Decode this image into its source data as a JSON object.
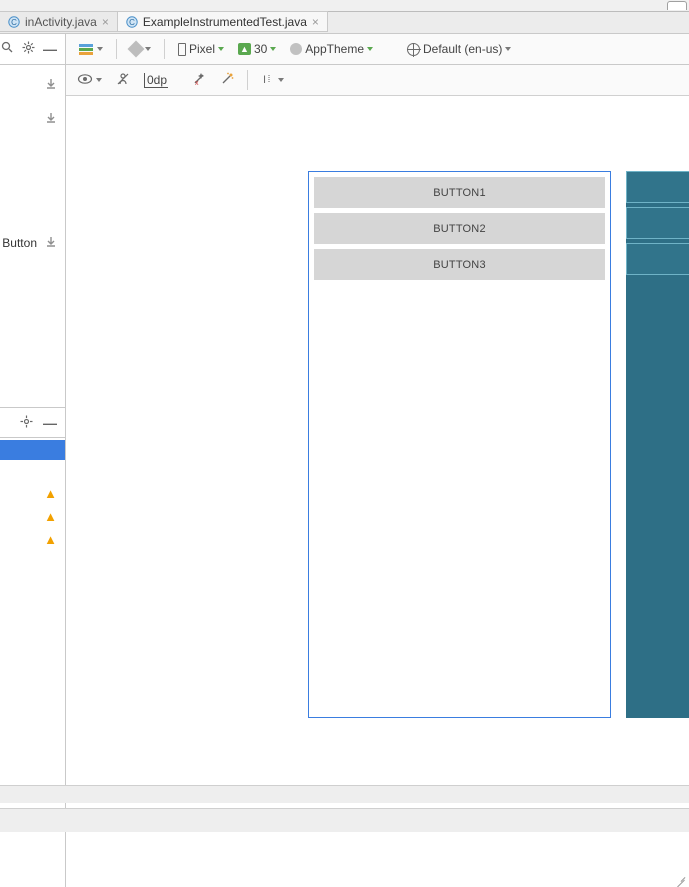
{
  "tabs": [
    {
      "label": "inActivity.java",
      "icon_letter": "C",
      "active": false
    },
    {
      "label": "ExampleInstrumentedTest.java",
      "icon_letter": "C",
      "active": true
    }
  ],
  "palette": {
    "button_label": "Button"
  },
  "toolbar1": {
    "device_label": "Pixel",
    "api_label": "30",
    "theme_label": "AppTheme",
    "locale_label": "Default (en-us)"
  },
  "toolbar2": {
    "dp_label": "0dp"
  },
  "layout_buttons": [
    "BUTTON1",
    "BUTTON2",
    "BUTTON3"
  ],
  "tree": {
    "warning_count": 3
  }
}
